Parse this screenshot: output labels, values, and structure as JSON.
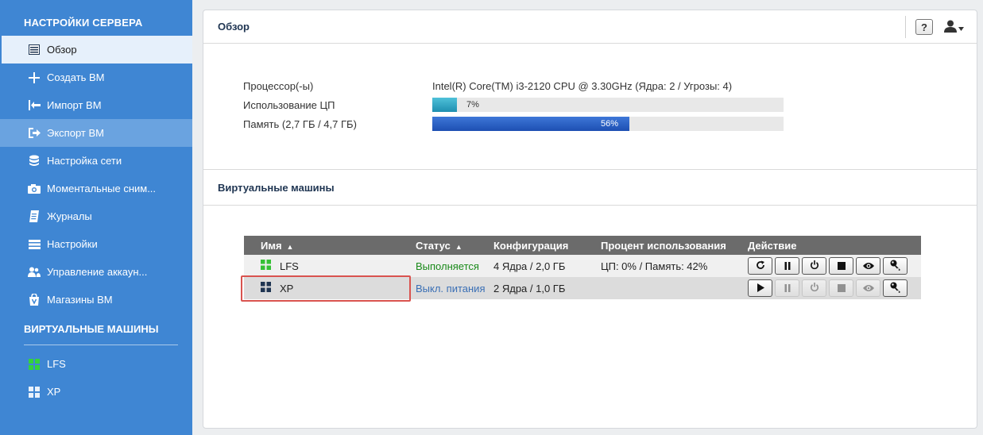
{
  "sidebar": {
    "header": "НАСТРОЙКИ СЕРВЕРА",
    "items": [
      {
        "label": "Обзор",
        "icon": "overview-icon"
      },
      {
        "label": "Создать ВМ",
        "icon": "plus-icon"
      },
      {
        "label": "Импорт ВМ",
        "icon": "import-icon"
      },
      {
        "label": "Экспорт ВМ",
        "icon": "export-icon"
      },
      {
        "label": "Настройка сети",
        "icon": "network-icon"
      },
      {
        "label": "Моментальные сним...",
        "icon": "camera-icon"
      },
      {
        "label": "Журналы",
        "icon": "logs-icon"
      },
      {
        "label": "Настройки",
        "icon": "settings-icon"
      },
      {
        "label": "Управление аккаун...",
        "icon": "accounts-icon"
      },
      {
        "label": "Магазины ВМ",
        "icon": "store-icon"
      }
    ],
    "vm_header": "ВИРТУАЛЬНЫЕ МАШИНЫ",
    "vms": [
      {
        "label": "LFS",
        "icon": "windows-green-icon"
      },
      {
        "label": "XP",
        "icon": "windows-white-icon"
      }
    ]
  },
  "overview": {
    "title": "Обзор",
    "help_label": "?",
    "cpu_label": "Процессор(-ы)",
    "cpu_value": "Intel(R) Core(TM) i3-2120 CPU @ 3.30GHz (Ядра: 2 / Угрозы: 4)",
    "cpu_usage_label": "Использование ЦП",
    "cpu_usage_text": "7%",
    "cpu_usage_fraction": 0.07,
    "memory_label": "Память (2,7 ГБ / 4,7 ГБ)",
    "memory_text": "56%",
    "memory_fraction": 0.56
  },
  "vm_section": {
    "title": "Виртуальные машины",
    "columns": {
      "name": "Имя",
      "status": "Статус",
      "config": "Конфигурация",
      "usage": "Процент использования",
      "action": "Действие"
    },
    "sort_arrow": "▲",
    "rows": [
      {
        "name": "LFS",
        "status": "Выполняется",
        "config": "4 Ядра / 2,0 ГБ",
        "usage": "ЦП: 0% / Память: 42%",
        "status_color": "#1a8a1a"
      },
      {
        "name": "XP",
        "status": "Выкл. питания",
        "config": "2 Ядра / 1,0 ГБ",
        "usage": "",
        "status_color": "#3a6fb5"
      }
    ]
  },
  "colors": {
    "sidebar_bg": "#3f86d3",
    "highlight": "#d9534f"
  }
}
